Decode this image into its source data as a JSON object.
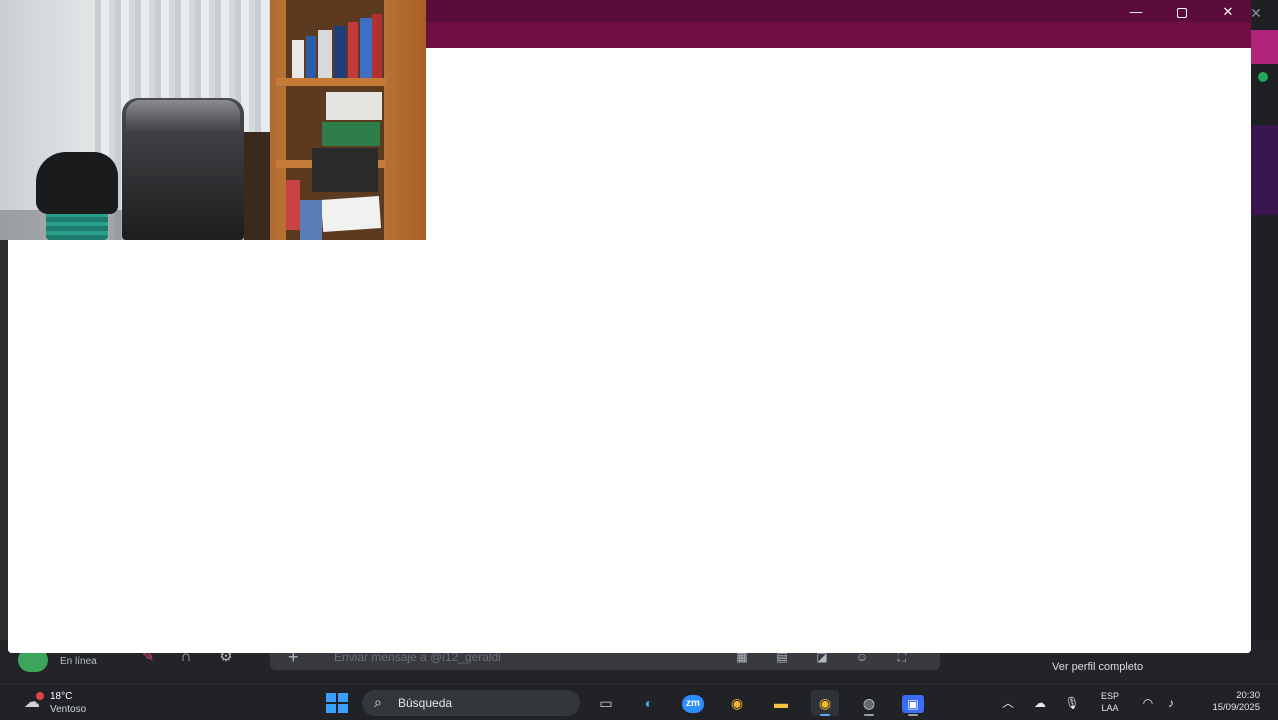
{
  "discord": {
    "status_text": "En línea",
    "message_placeholder": "Enviar mensaje a @i12_geraldi",
    "ver_perfil": "Ver perfil completo"
  },
  "window": {
    "minimize_glyph": "—",
    "close_glyph": "✕"
  },
  "taskbar": {
    "weather_temp": "18°C",
    "weather_desc": "Ventoso",
    "search_placeholder": "Búsqueda",
    "apps": [
      {
        "name": "file-explorer-task",
        "glyph": "▭"
      },
      {
        "name": "edge",
        "glyph": "◐"
      },
      {
        "name": "zoom",
        "glyph": "zm"
      },
      {
        "name": "chrome",
        "glyph": "◉"
      },
      {
        "name": "folder",
        "glyph": "▬"
      },
      {
        "name": "chrome-profile",
        "glyph": "◉"
      },
      {
        "name": "discord-app",
        "glyph": "◍"
      },
      {
        "name": "screen-app",
        "glyph": "▣"
      }
    ],
    "lang_line1": "ESP",
    "lang_line2": "LAA",
    "time": "20:30",
    "date": "15/09/2025"
  },
  "colors": {
    "titlebar": "#6e0e45",
    "taskbar": "#202225",
    "accent": "#3aa0ff"
  }
}
